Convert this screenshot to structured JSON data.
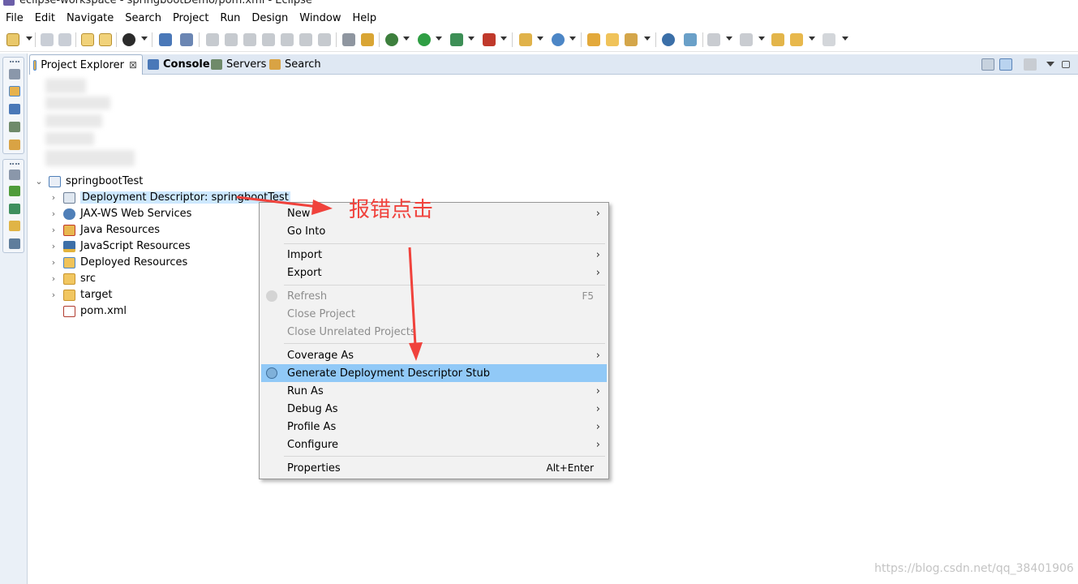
{
  "window": {
    "title": "eclipse-workspace - springbootDemo/pom.xml - Eclipse"
  },
  "menu": [
    "File",
    "Edit",
    "Navigate",
    "Search",
    "Project",
    "Run",
    "Design",
    "Window",
    "Help"
  ],
  "view_tabs": [
    {
      "label": "Project Explorer",
      "icon": "project-explorer-icon",
      "active": true,
      "close": "⊠"
    },
    {
      "label": "Console",
      "icon": "console-icon",
      "active": false,
      "bold": true
    },
    {
      "label": "Servers",
      "icon": "servers-icon",
      "active": false
    },
    {
      "label": "Search",
      "icon": "search-icon",
      "active": false
    }
  ],
  "tree": {
    "project": {
      "label": "springbootTest",
      "expander": "⌄"
    },
    "children": [
      {
        "label": "Deployment Descriptor: springbootTest",
        "icon": "deployment-descriptor-icon",
        "expander": "›",
        "selected": true
      },
      {
        "label": "JAX-WS Web Services",
        "icon": "web-services-icon",
        "expander": "›"
      },
      {
        "label": "Java Resources",
        "icon": "java-resources-icon",
        "expander": "›"
      },
      {
        "label": "JavaScript Resources",
        "icon": "javascript-resources-icon",
        "expander": "›"
      },
      {
        "label": "Deployed Resources",
        "icon": "deployed-resources-icon",
        "expander": "›"
      },
      {
        "label": "src",
        "icon": "folder-icon",
        "expander": "›"
      },
      {
        "label": "target",
        "icon": "folder-icon",
        "expander": "›"
      },
      {
        "label": "pom.xml",
        "icon": "xml-file-icon",
        "expander": ""
      }
    ]
  },
  "context_menu": {
    "groups": [
      [
        {
          "label": "New",
          "submenu": "›"
        },
        {
          "label": "Go Into"
        }
      ],
      [
        {
          "label": "Import",
          "submenu": "›"
        },
        {
          "label": "Export",
          "submenu": "›"
        }
      ],
      [
        {
          "label": "Refresh",
          "accel": "F5",
          "disabled": true,
          "icon": "refresh-icon"
        },
        {
          "label": "Close Project",
          "disabled": true
        },
        {
          "label": "Close Unrelated Projects",
          "disabled": true
        }
      ],
      [
        {
          "label": "Coverage As",
          "submenu": "›"
        },
        {
          "label": "Generate Deployment Descriptor Stub",
          "highlight": true,
          "icon": "generate-stub-icon"
        },
        {
          "label": "Run As",
          "submenu": "›"
        },
        {
          "label": "Debug As",
          "submenu": "›"
        },
        {
          "label": "Profile As",
          "submenu": "›"
        },
        {
          "label": "Configure",
          "submenu": "›"
        }
      ],
      [
        {
          "label": "Properties",
          "accel": "Alt+Enter"
        }
      ]
    ]
  },
  "annotation": {
    "text": "报错点击",
    "color": "#f0423c"
  },
  "watermark": "https://blog.csdn.net/qq_38401906",
  "colors": {
    "selection": "#cde8ff",
    "menu_highlight": "#91c9f7",
    "tab_strip": "#dfe8f3",
    "arrow": "#f0423c"
  }
}
